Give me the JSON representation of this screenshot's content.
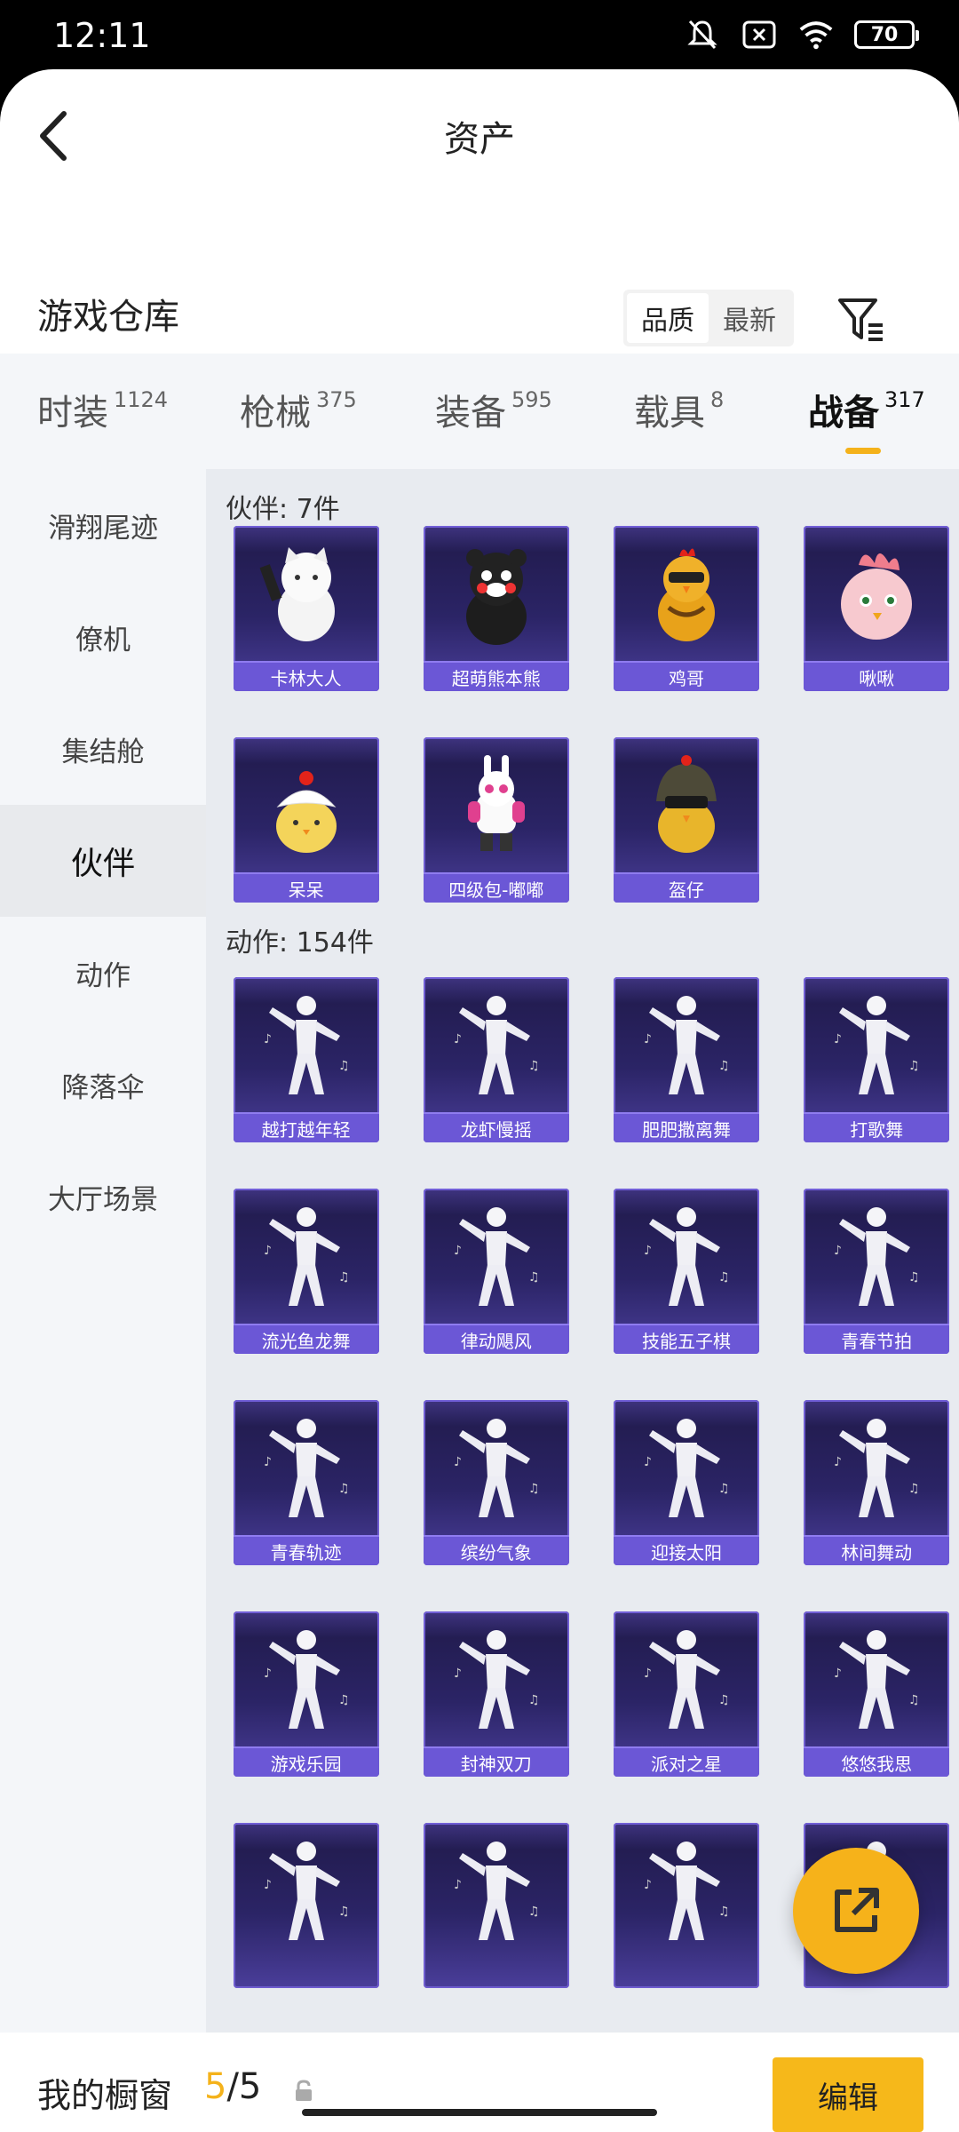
{
  "status_bar": {
    "time": "12:11",
    "battery": "70"
  },
  "header": {
    "title": "资产"
  },
  "section": {
    "title": "游戏仓库"
  },
  "sort": {
    "options": [
      {
        "label": "品质",
        "active": true
      },
      {
        "label": "最新",
        "active": false
      }
    ]
  },
  "tabs": [
    {
      "label": "时装",
      "count": "1124"
    },
    {
      "label": "枪械",
      "count": "375"
    },
    {
      "label": "装备",
      "count": "595"
    },
    {
      "label": "载具",
      "count": "8"
    },
    {
      "label": "战备",
      "count": "317",
      "active": true
    }
  ],
  "sidebar": {
    "items": [
      {
        "label": "滑翔尾迹"
      },
      {
        "label": "僚机"
      },
      {
        "label": "集结舱"
      },
      {
        "label": "伙伴",
        "active": true
      },
      {
        "label": "动作"
      },
      {
        "label": "降落伞"
      },
      {
        "label": "大厅场景"
      }
    ]
  },
  "groups": {
    "partners": {
      "title": "伙伴: 7件",
      "items": [
        {
          "name": "卡林大人",
          "icon": "white-cat-icon"
        },
        {
          "name": "超萌熊本熊",
          "icon": "black-bear-icon"
        },
        {
          "name": "鸡哥",
          "icon": "chicken-icon"
        },
        {
          "name": "啾啾",
          "icon": "pink-bird-icon"
        },
        {
          "name": "呆呆",
          "icon": "yellow-chick-icon"
        },
        {
          "name": "四级包-嘟嘟",
          "icon": "robot-bunny-icon"
        },
        {
          "name": "盔仔",
          "icon": "helmet-chick-icon"
        }
      ]
    },
    "emotes": {
      "title": "动作: 154件",
      "items": [
        {
          "name": "越打越年轻",
          "icon": "dance-figure-icon"
        },
        {
          "name": "龙虾慢摇",
          "icon": "dance-figure-icon"
        },
        {
          "name": "肥肥撒离舞",
          "icon": "dance-figure-icon"
        },
        {
          "name": "打歌舞",
          "icon": "dance-figure-icon"
        },
        {
          "name": "流光鱼龙舞",
          "icon": "dance-figure-icon"
        },
        {
          "name": "律动飓风",
          "icon": "dance-figure-icon"
        },
        {
          "name": "技能五子棋",
          "icon": "dance-figure-icon"
        },
        {
          "name": "青春节拍",
          "icon": "dance-figure-icon"
        },
        {
          "name": "青春轨迹",
          "icon": "dance-figure-icon"
        },
        {
          "name": "缤纷气象",
          "icon": "dance-figure-icon"
        },
        {
          "name": "迎接太阳",
          "icon": "dance-figure-icon"
        },
        {
          "name": "林间舞动",
          "icon": "dance-figure-icon"
        },
        {
          "name": "游戏乐园",
          "icon": "dance-figure-icon"
        },
        {
          "name": "封神双刀",
          "icon": "dance-figure-icon"
        },
        {
          "name": "派对之星",
          "icon": "dance-figure-icon"
        },
        {
          "name": "悠悠我思",
          "icon": "dance-figure-icon"
        },
        {
          "name": "",
          "icon": "dance-figure-icon"
        },
        {
          "name": "",
          "icon": "dance-figure-icon"
        },
        {
          "name": "",
          "icon": "dance-figure-icon"
        },
        {
          "name": "",
          "icon": "dance-figure-icon"
        }
      ]
    }
  },
  "bottom": {
    "label": "我的橱窗",
    "current": "5",
    "total": "/5",
    "edit_label": "编辑"
  },
  "colors": {
    "accent": "#f4b21b",
    "card_bg": "#2b2466",
    "card_label": "#6b57d6"
  }
}
